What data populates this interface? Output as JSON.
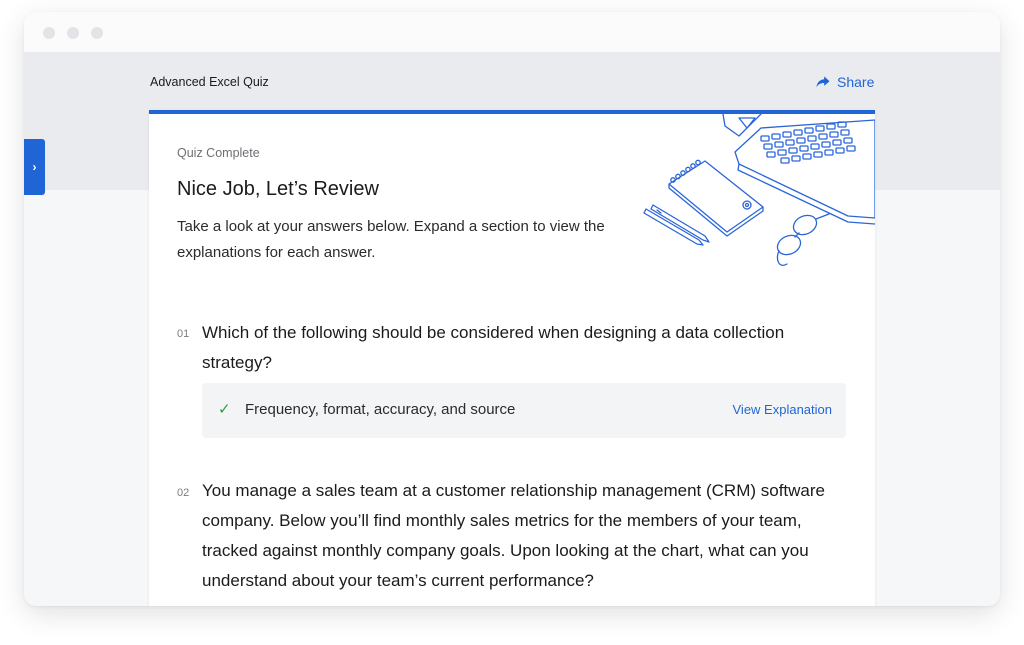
{
  "header": {
    "quiz_title": "Advanced Excel Quiz",
    "share_label": "Share"
  },
  "summary": {
    "status": "Quiz Complete",
    "heading": "Nice Job, Let’s Review",
    "intro": "Take a look at your answers below. Expand a section to view the explanations for each answer."
  },
  "questions": [
    {
      "number": "01",
      "text": "Which of the following should be considered when designing a data collection strategy?",
      "answer": "Frequency, format, accuracy, and source",
      "link": "View Explanation"
    },
    {
      "number": "02",
      "text": "You manage a sales team at a customer relationship management (CRM) software company. Below you’ll find monthly sales metrics for the members of your team, tracked against monthly company goals. Upon looking at the chart, what can you understand about your team’s current performance?"
    }
  ],
  "icons": {
    "sidebar_toggle": "chevron-right-icon",
    "share": "share-arrow-icon",
    "answer_status": "checkmark-icon",
    "illustration": "laptop-notebook-glasses-illustration"
  },
  "colors": {
    "accent": "#1f65d6",
    "correct": "#2f9e44"
  }
}
